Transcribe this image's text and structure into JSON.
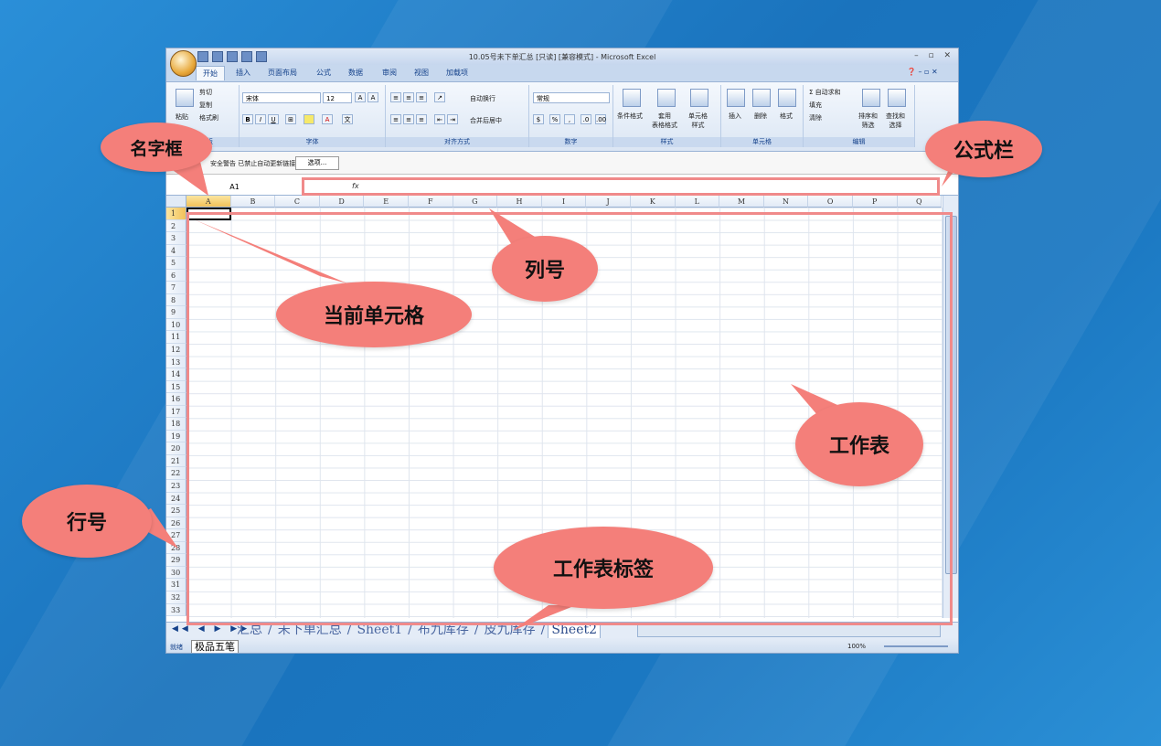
{
  "window": {
    "title": "10.05号未下单汇总 [只读] [兼容模式] - Microsoft Excel",
    "office_button_label": "Office"
  },
  "tabs": [
    "开始",
    "插入",
    "页面布局",
    "公式",
    "数据",
    "审阅",
    "视图",
    "加载项"
  ],
  "ribbon": {
    "clipboard": {
      "paste": "粘贴",
      "cut": "剪切",
      "copy": "复制",
      "format_painter": "格式刷",
      "label": "剪贴板"
    },
    "font": {
      "name": "宋体",
      "size": "12",
      "label": "字体",
      "bold": "B",
      "italic": "I",
      "underline": "U"
    },
    "alignment": {
      "wrap": "自动换行",
      "merge": "合并后居中",
      "label": "对齐方式"
    },
    "number": {
      "format": "常规",
      "label": "数字",
      "percent": "%"
    },
    "styles": {
      "conditional": "条件格式",
      "table": "套用\n表格格式",
      "cell_styles": "单元格\n样式",
      "label": "样式"
    },
    "cells": {
      "insert": "插入",
      "delete": "删除",
      "format": "格式",
      "label": "单元格"
    },
    "editing": {
      "autosum": "Σ 自动求和",
      "fill": "填充",
      "clear": "清除",
      "sort": "排序和\n筛选",
      "find": "查找和\n选择",
      "label": "编辑"
    }
  },
  "security": {
    "message": "安全警告  已禁止自动更新链接",
    "options_button": "选项..."
  },
  "formula_bar": {
    "name_box": "A1",
    "fx": "fx"
  },
  "columns": [
    "A",
    "B",
    "C",
    "D",
    "E",
    "F",
    "G",
    "H",
    "I",
    "J",
    "K",
    "L",
    "M",
    "N",
    "O",
    "P",
    "Q"
  ],
  "rows": [
    "1",
    "2",
    "3",
    "4",
    "5",
    "6",
    "7",
    "8",
    "9",
    "10",
    "11",
    "12",
    "13",
    "14",
    "15",
    "16",
    "17",
    "18",
    "19",
    "20",
    "21",
    "22",
    "23",
    "24",
    "25",
    "26",
    "27",
    "28",
    "29",
    "30",
    "31",
    "32",
    "33"
  ],
  "sheet_tabs": [
    "汇总",
    "未下单汇总",
    "Sheet1",
    "布九库存",
    "皮九库存",
    "Sheet2"
  ],
  "status": {
    "ready": "就绪",
    "ime": "极品五笔",
    "zoom": "100%"
  },
  "callouts": {
    "name_box": "名字框",
    "formula_bar": "公式栏",
    "column_number": "列号",
    "current_cell": "当前单元格",
    "worksheet": "工作表",
    "row_number": "行号",
    "sheet_tab": "工作表标签"
  },
  "colors": {
    "callout": "#f47f7a",
    "highlight": "#f08a8a",
    "background": "#1b78c2"
  }
}
